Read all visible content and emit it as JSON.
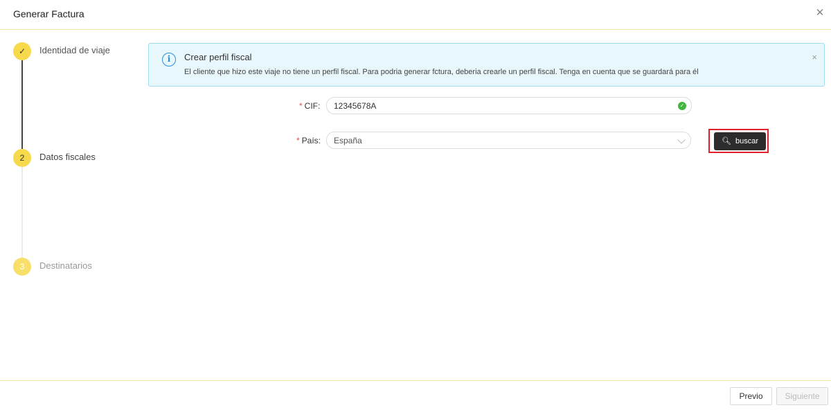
{
  "modal": {
    "title": "Generar Factura",
    "close_icon": "close-icon"
  },
  "steps": [
    {
      "number": "✓",
      "label": "Identidad de viaje",
      "status": "done"
    },
    {
      "number": "2",
      "label": "Datos fiscales",
      "status": "current"
    },
    {
      "number": "3",
      "label": "Destinatarios",
      "status": "pending"
    }
  ],
  "alert": {
    "title": "Crear perfil fiscal",
    "text": "El cliente que hizo este viaje no tiene un perfil fiscal. Para podria generar fctura, deberia crearle un perfil fiscal. Tenga en cuenta que se guardará para él",
    "info_icon": "i",
    "close": "×"
  },
  "form": {
    "cif_label": "CIF:",
    "cif_value": "12345678A",
    "pais_label": "País:",
    "pais_value": "España",
    "search_label": "buscar",
    "required_mark": "*"
  },
  "footer": {
    "prev_label": "Previo",
    "next_label": "Siguiente"
  },
  "colors": {
    "accent": "#f7d94c",
    "alert_bg": "#e8f7fc",
    "alert_border": "#9fdcf0",
    "info": "#2a8ee0",
    "success": "#43b43e",
    "highlight": "#e0202a"
  }
}
